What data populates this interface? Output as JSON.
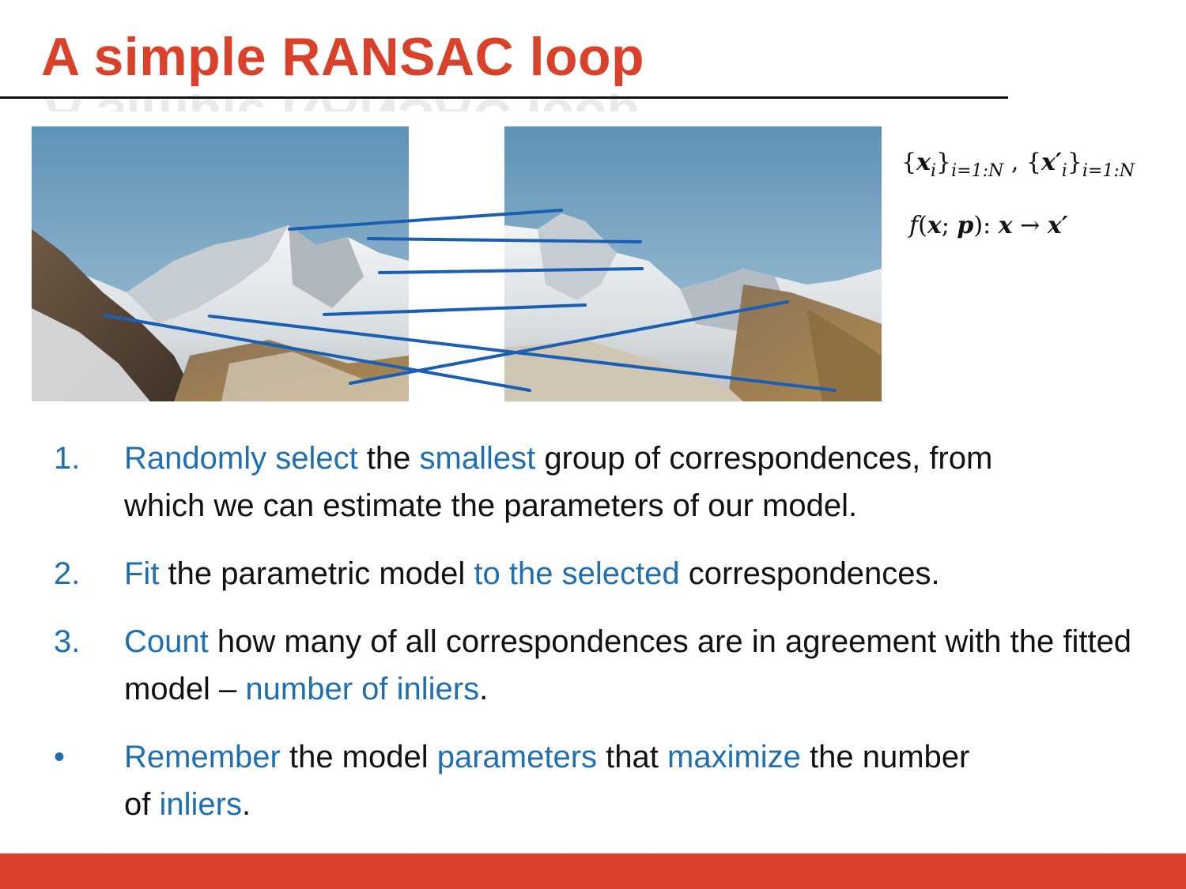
{
  "slide": {
    "title": "A simple RANSAC loop",
    "math": {
      "sets": {
        "x_symbol": "x",
        "x_index": "i",
        "subscript": "i=1:N",
        "separator": ",",
        "xp_symbol": "x′",
        "xp_index": "i"
      },
      "mapping": {
        "f": "f",
        "x1": "x",
        "p": "p",
        "x2": "x",
        "arrow": "→",
        "x3": "x′"
      }
    },
    "steps": [
      {
        "marker": "1.",
        "segments": [
          {
            "text": "Randomly select",
            "highlight": true
          },
          {
            "text": " the ",
            "highlight": false
          },
          {
            "text": "smallest",
            "highlight": true
          },
          {
            "text": " group of correspondences, from which we can estimate the parameters of our model.",
            "highlight": false
          }
        ]
      },
      {
        "marker": "2.",
        "segments": [
          {
            "text": "Fit",
            "highlight": true
          },
          {
            "text": " the parametric model ",
            "highlight": false
          },
          {
            "text": "to the selected",
            "highlight": true
          },
          {
            "text": " correspondences.",
            "highlight": false
          }
        ]
      },
      {
        "marker": "3.",
        "segments": [
          {
            "text": "Count",
            "highlight": true
          },
          {
            "text": " how many of all correspondences are in agreement with the fitted model – ",
            "highlight": false
          },
          {
            "text": "number of inliers",
            "highlight": true
          },
          {
            "text": ".",
            "highlight": false
          }
        ]
      },
      {
        "marker": "•",
        "segments": [
          {
            "text": "Remember",
            "highlight": true
          },
          {
            "text": " the model ",
            "highlight": false
          },
          {
            "text": "parameters",
            "highlight": true
          },
          {
            "text": " that ",
            "highlight": false
          },
          {
            "text": "maximize",
            "highlight": true
          },
          {
            "text": " the number of ",
            "highlight": false
          },
          {
            "text": "inliers",
            "highlight": true
          },
          {
            "text": ".",
            "highlight": false
          }
        ]
      }
    ]
  },
  "colors": {
    "title": "#d9412a",
    "accent_blue": "#1f6fb0",
    "footer_bar": "#d9412a",
    "match_line": "#1a5fb4",
    "sky": "#6e9fc0"
  },
  "images": [
    {
      "name": "mountain-photo-left",
      "content": "snowy mountain panorama, left view"
    },
    {
      "name": "mountain-photo-right",
      "content": "snowy mountain panorama, right view"
    }
  ],
  "correspondences": {
    "count": 7
  }
}
